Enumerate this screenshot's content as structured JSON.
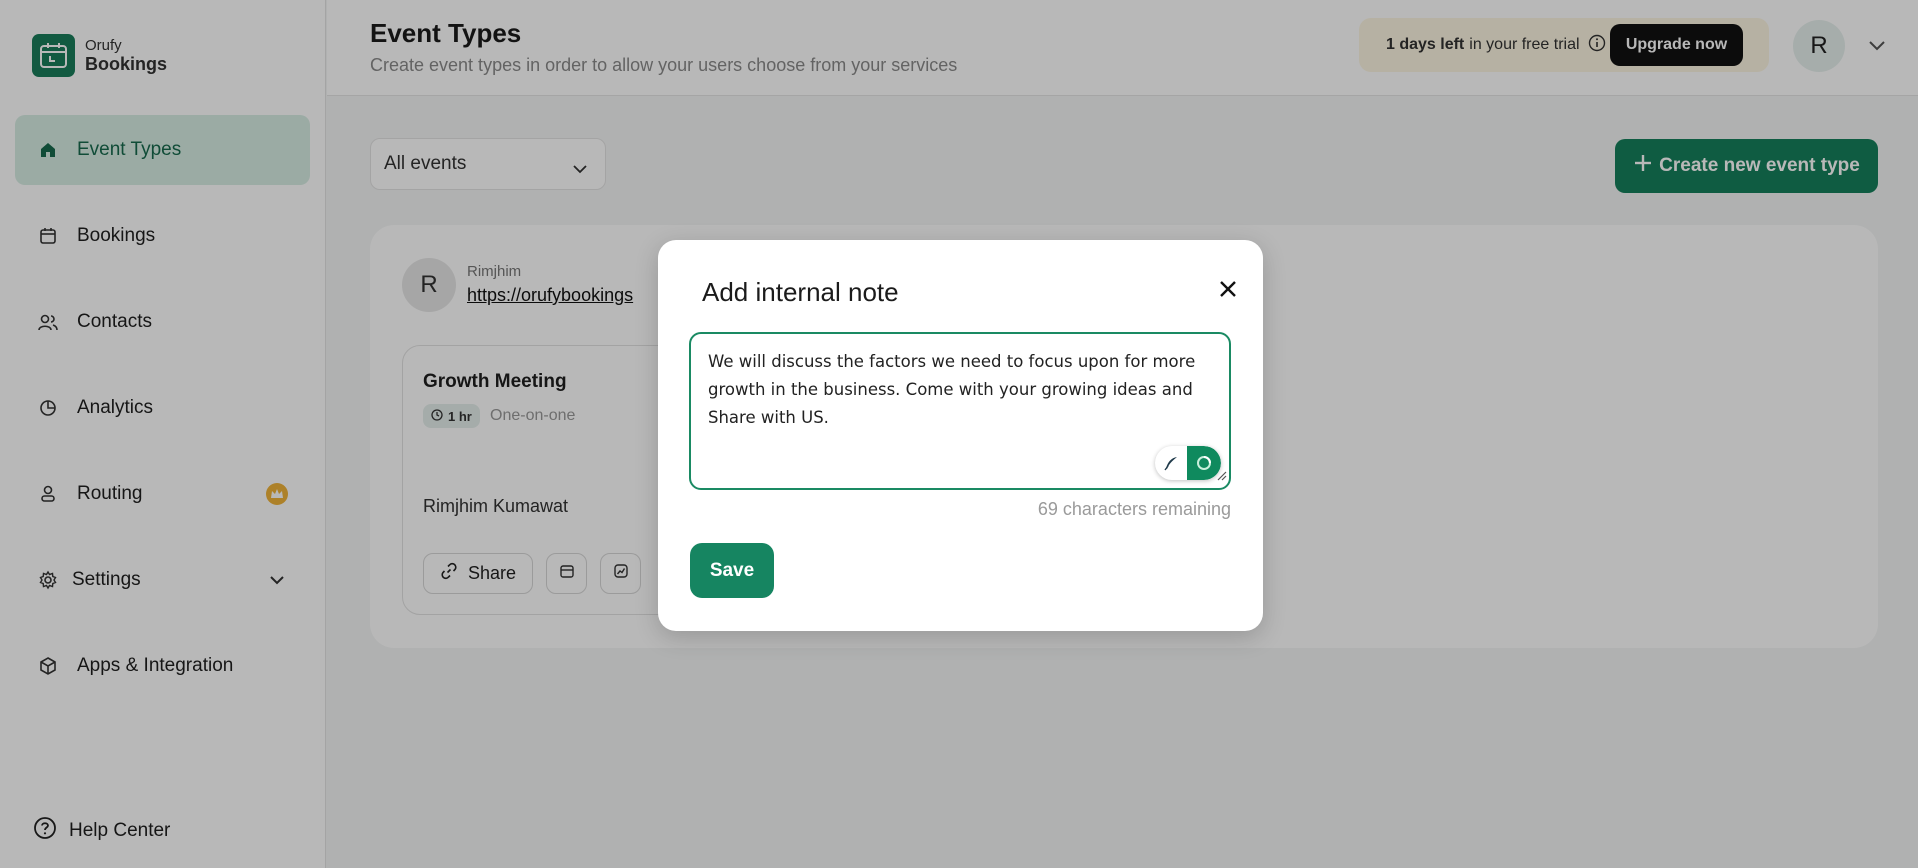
{
  "brand": {
    "line1": "Orufy",
    "line2": "Bookings"
  },
  "sidebar": {
    "items": [
      {
        "label": "Event Types",
        "icon": "home-icon"
      },
      {
        "label": "Bookings",
        "icon": "calendar-icon"
      },
      {
        "label": "Contacts",
        "icon": "users-icon"
      },
      {
        "label": "Analytics",
        "icon": "pie-chart-icon"
      },
      {
        "label": "Routing",
        "icon": "person-icon"
      },
      {
        "label": "Settings",
        "icon": "gear-icon"
      },
      {
        "label": "Apps & Integration",
        "icon": "box-icon"
      }
    ],
    "help": "Help Center"
  },
  "header": {
    "title": "Event Types",
    "subtitle": "Create event types in order to allow your users choose from your services",
    "trial_bold": "1 days left",
    "trial_rest": "in your free trial",
    "upgrade_label": "Upgrade now",
    "avatar_initial": "R"
  },
  "main": {
    "filter_value": "All events",
    "create_label": "Create new event type",
    "owner": {
      "initial": "R",
      "name": "Rimjhim",
      "link": "https://orufybookings"
    },
    "event": {
      "title": "Growth Meeting",
      "duration": "1 hr",
      "type": "One-on-one",
      "host": "Rimjhim Kumawat",
      "share_label": "Share"
    }
  },
  "modal": {
    "title": "Add internal note",
    "note": "We will discuss the factors we need to focus upon for more growth in the business. Come with your growing ideas and Share with US.",
    "remaining": "69 characters remaining",
    "save_label": "Save"
  },
  "colors": {
    "brand_green": "#15805c",
    "active_nav_bg": "#d7ede4",
    "trial_bg": "#fdf6e2",
    "crown": "#f0b33a"
  }
}
